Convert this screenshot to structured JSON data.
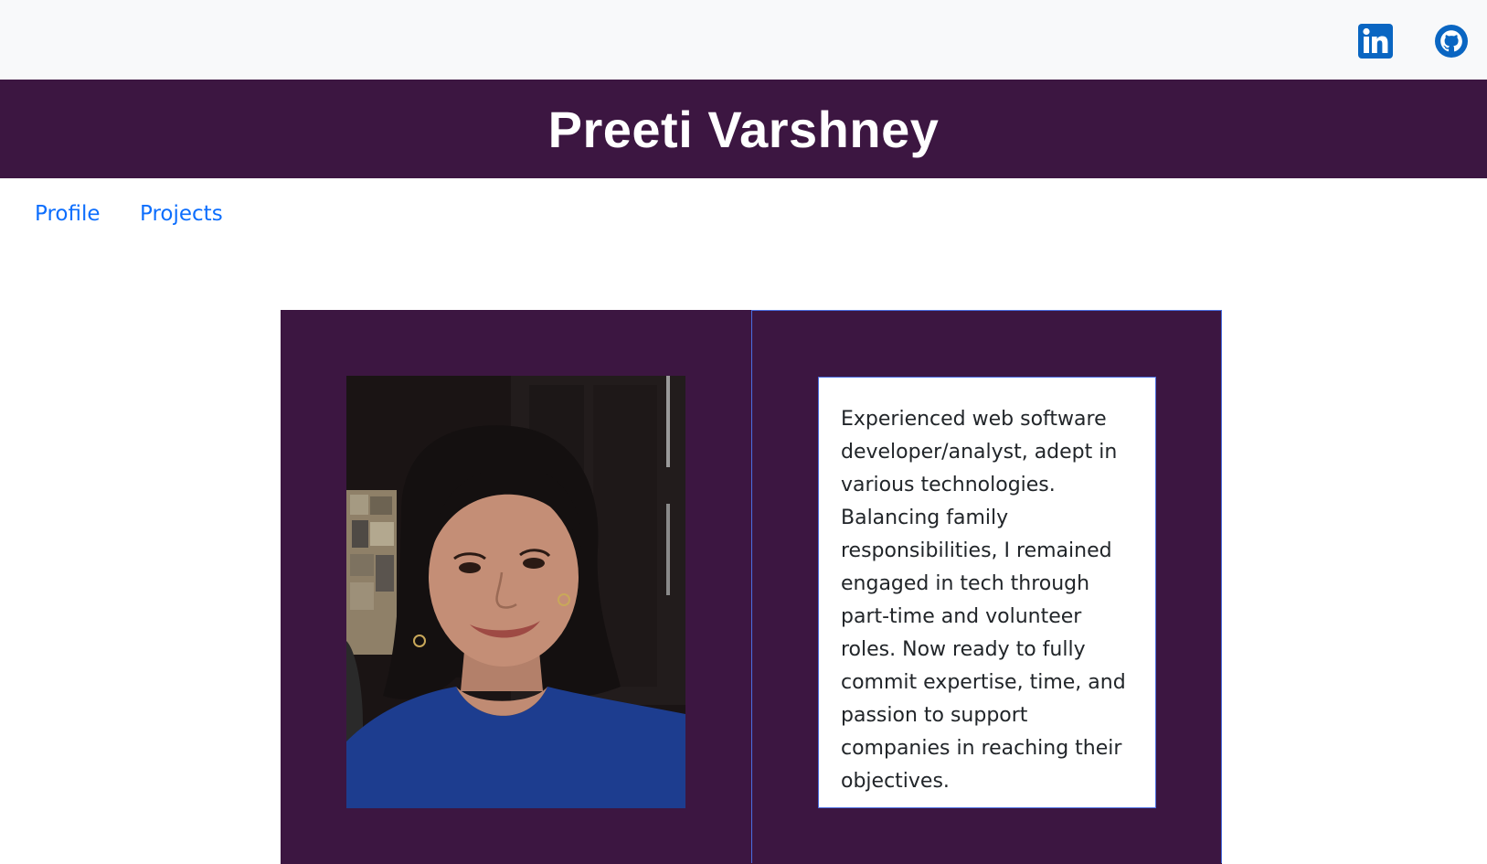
{
  "header": {
    "social": [
      {
        "name": "LinkedIn",
        "icon": "linkedin-icon"
      },
      {
        "name": "GitHub",
        "icon": "github-icon"
      }
    ]
  },
  "banner": {
    "name": "Preeti Varshney"
  },
  "nav": {
    "items": [
      {
        "label": "Profile"
      },
      {
        "label": "Projects"
      }
    ]
  },
  "profile": {
    "photo_alt": "profile-photo",
    "bio": "Experienced web software developer/analyst, adept in various technologies. Balancing family responsibilities, I remained engaged in tech through part-time and volunteer roles. Now ready to fully commit expertise, time, and passion to support companies in reaching their objectives."
  },
  "colors": {
    "brand": "#3c1641",
    "link": "#0d6efd",
    "topbar": "#f8f9fa",
    "linkedin": "#0a66c2"
  }
}
